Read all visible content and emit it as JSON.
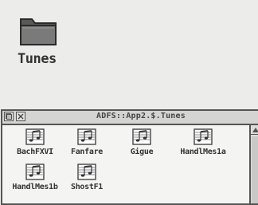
{
  "desktop": {
    "icon": "folder-icon",
    "label": "Tunes"
  },
  "window": {
    "title": "ADFS::App2.$.Tunes",
    "back_icon": "back-icon",
    "close_icon": "close-icon",
    "scroll_up_icon": "scroll-up-arrow-icon",
    "files": [
      {
        "name": "BachFXVI",
        "icon": "music-file-icon"
      },
      {
        "name": "Fanfare",
        "icon": "music-file-icon"
      },
      {
        "name": "Gigue",
        "icon": "music-file-icon"
      },
      {
        "name": "HandlMes1a",
        "icon": "music-file-icon"
      },
      {
        "name": "HandlMes1b",
        "icon": "music-file-icon"
      },
      {
        "name": "ShostF1",
        "icon": "music-file-icon"
      }
    ]
  }
}
